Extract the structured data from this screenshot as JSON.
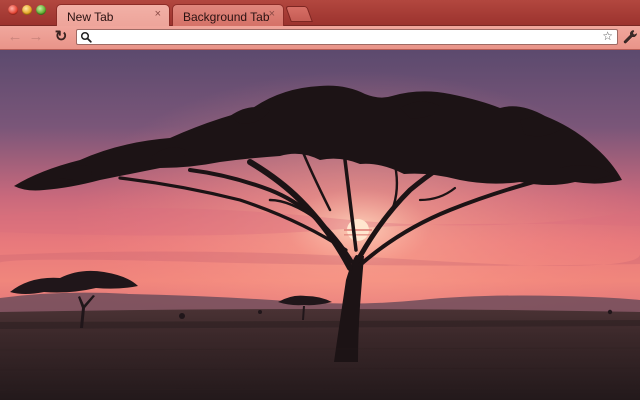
{
  "window": {
    "controls": [
      "close",
      "minimize",
      "maximize"
    ]
  },
  "tabs": [
    {
      "label": "New Tab",
      "active": true,
      "close_glyph": "×"
    },
    {
      "label": "Background Tab",
      "active": false,
      "close_glyph": "×"
    }
  ],
  "toolbar": {
    "back_glyph": "←",
    "forward_glyph": "→",
    "reload_glyph": "↻",
    "star_glyph": "☆",
    "icons": [
      "back-arrow-icon",
      "forward-arrow-icon",
      "reload-icon",
      "search-icon",
      "bookmark-star-icon",
      "wrench-icon"
    ]
  },
  "omnibox": {
    "value": "",
    "placeholder": ""
  },
  "theme": {
    "frame_color": "#a83b35",
    "toolbar_color": "#ec9c91",
    "background_image": "savanna-sunset-acacia-tree"
  }
}
